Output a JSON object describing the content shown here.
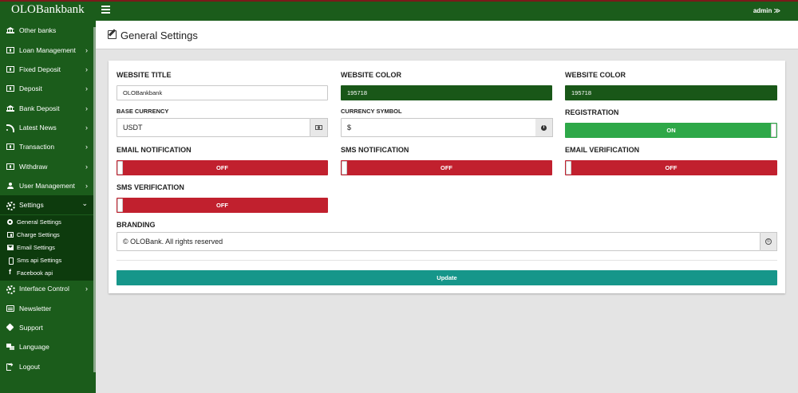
{
  "app": {
    "brand": "OLOBankbank",
    "user": "admin ≫",
    "colors": {
      "primary_green": "#1b5c1b",
      "active_dark": "#0d3b0d",
      "website_color": "#195718",
      "off_red": "#c1202e",
      "on_green": "#2ea848",
      "update_teal": "#16968a"
    }
  },
  "sidebar": {
    "items": [
      {
        "label": "Other banks",
        "icon": "bank-icon"
      },
      {
        "label": "Loan Management",
        "icon": "money-icon"
      },
      {
        "label": "Fixed Deposit",
        "icon": "money-icon"
      },
      {
        "label": "Deposit",
        "icon": "money-icon"
      },
      {
        "label": "Bank Deposit",
        "icon": "bank-icon"
      },
      {
        "label": "Latest News",
        "icon": "rss-icon"
      },
      {
        "label": "Transaction",
        "icon": "money-icon"
      },
      {
        "label": "Withdraw",
        "icon": "money-icon"
      },
      {
        "label": "User Management",
        "icon": "user-icon"
      },
      {
        "label": "Settings",
        "icon": "gears-icon"
      },
      {
        "label": "Interface Control",
        "icon": "gears-icon"
      },
      {
        "label": "Newsletter",
        "icon": "newspaper-icon"
      },
      {
        "label": "Support",
        "icon": "tag-icon"
      },
      {
        "label": "Language",
        "icon": "language-icon"
      },
      {
        "label": "Logout",
        "icon": "logout-icon"
      }
    ],
    "settings_sub": [
      {
        "label": "General Settings",
        "icon": "cog-icon"
      },
      {
        "label": "Charge Settings",
        "icon": "money-icon"
      },
      {
        "label": "Email Settings",
        "icon": "envelope-icon"
      },
      {
        "label": "Sms api Settings",
        "icon": "mobile-icon"
      },
      {
        "label": "Facebook api",
        "icon": "facebook-icon"
      }
    ]
  },
  "header": {
    "title": "General Settings"
  },
  "form": {
    "website_title": {
      "label": "WEBSITE TITLE",
      "value": "OLOBankbank"
    },
    "website_color_1": {
      "label": "WEBSITE COLOR",
      "value": "195718"
    },
    "website_color_2": {
      "label": "WEBSITE COLOR",
      "value": "195718"
    },
    "base_currency": {
      "label": "BASE CURRENCY",
      "value": "USDT"
    },
    "currency_symbol": {
      "label": "CURRENCY SYMBOL",
      "value": "$"
    },
    "registration": {
      "label": "REGISTRATION",
      "state": "ON"
    },
    "email_notification": {
      "label": "EMAIL NOTIFICATION",
      "state": "OFF"
    },
    "sms_notification": {
      "label": "SMS NOTIFICATION",
      "state": "OFF"
    },
    "email_verification": {
      "label": "EMAIL VERIFICATION",
      "state": "OFF"
    },
    "sms_verification": {
      "label": "SMS VERIFICATION",
      "state": "OFF"
    },
    "branding": {
      "label": "BRANDING",
      "value": "©  OLOBank. All rights reserved"
    },
    "update_label": "Update"
  }
}
